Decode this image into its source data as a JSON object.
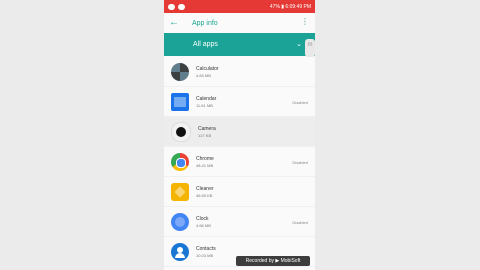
{
  "status_bar": {
    "left_icons": [
      "notification-icon",
      "youtube-icon"
    ],
    "right_text": "47% ▮ 6:09:49 PM",
    "color": "#e53935"
  },
  "app_bar": {
    "back_icon": "arrow-back-icon",
    "title": "App info",
    "overflow_icon": "more-vert-icon"
  },
  "filter": {
    "label": "All apps",
    "chevron": "⌄",
    "color": "#1aa396"
  },
  "record_badge": {
    "text": "m"
  },
  "apps": [
    {
      "name": "Calculator",
      "size": "4.83 MB",
      "status": "",
      "icon": "calculator-icon",
      "color": "#4f5b66"
    },
    {
      "name": "Calendar",
      "size": "11.61 MB",
      "status": "Disabled",
      "icon": "calendar-icon",
      "color": "#1a73e8"
    },
    {
      "name": "Camera",
      "size": "127 KB",
      "status": "",
      "icon": "camera-icon",
      "color": "#222222"
    },
    {
      "name": "Chrome",
      "size": "48.41 MB",
      "status": "Disabled",
      "icon": "chrome-icon",
      "color": "#34a853"
    },
    {
      "name": "Cleaner",
      "size": "46.69 KB",
      "status": "",
      "icon": "cleaner-icon",
      "color": "#f4b400"
    },
    {
      "name": "Clock",
      "size": "4.66 MB",
      "status": "Disabled",
      "icon": "clock-icon",
      "color": "#4285f4"
    },
    {
      "name": "Contacts",
      "size": "10.03 MB",
      "status": "",
      "icon": "contacts-icon",
      "color": "#1976d2"
    }
  ],
  "watermark": {
    "text": "Recorded by ▶ MobiSoft"
  }
}
